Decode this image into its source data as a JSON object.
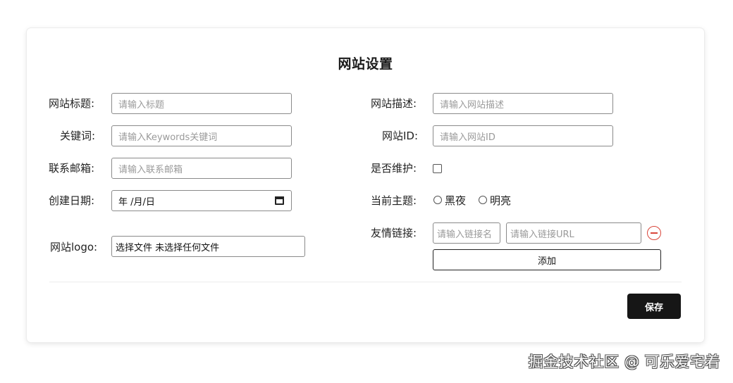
{
  "page": {
    "title": "网站设置"
  },
  "left": {
    "site_title": {
      "label": "网站标题:",
      "placeholder": "请输入标题"
    },
    "keywords": {
      "label": "关键词:",
      "placeholder": "请输入Keywords关键词"
    },
    "email": {
      "label": "联系邮箱:",
      "placeholder": "请输入联系邮箱"
    },
    "created_date": {
      "label": "创建日期:",
      "value": "年 /月/日"
    },
    "logo": {
      "label": "网站logo:",
      "value": "选择文件 未选择任何文件"
    }
  },
  "right": {
    "description": {
      "label": "网站描述:",
      "placeholder": "请输入网站描述"
    },
    "site_id": {
      "label": "网站ID:",
      "placeholder": "请输入网站ID"
    },
    "maintenance": {
      "label": "是否维护:",
      "checked": false
    },
    "theme": {
      "label": "当前主题:",
      "options": [
        "黑夜",
        "明亮"
      ]
    },
    "links": {
      "label": "友情链接:",
      "name_placeholder": "请输入链接名",
      "url_placeholder": "请输入链接URL",
      "add_label": "添加"
    }
  },
  "footer": {
    "save_label": "保存"
  },
  "watermark": "掘金技术社区 @ 可乐爱宅着",
  "colors": {
    "remove": "#d9453a",
    "save_bg": "#161616"
  }
}
